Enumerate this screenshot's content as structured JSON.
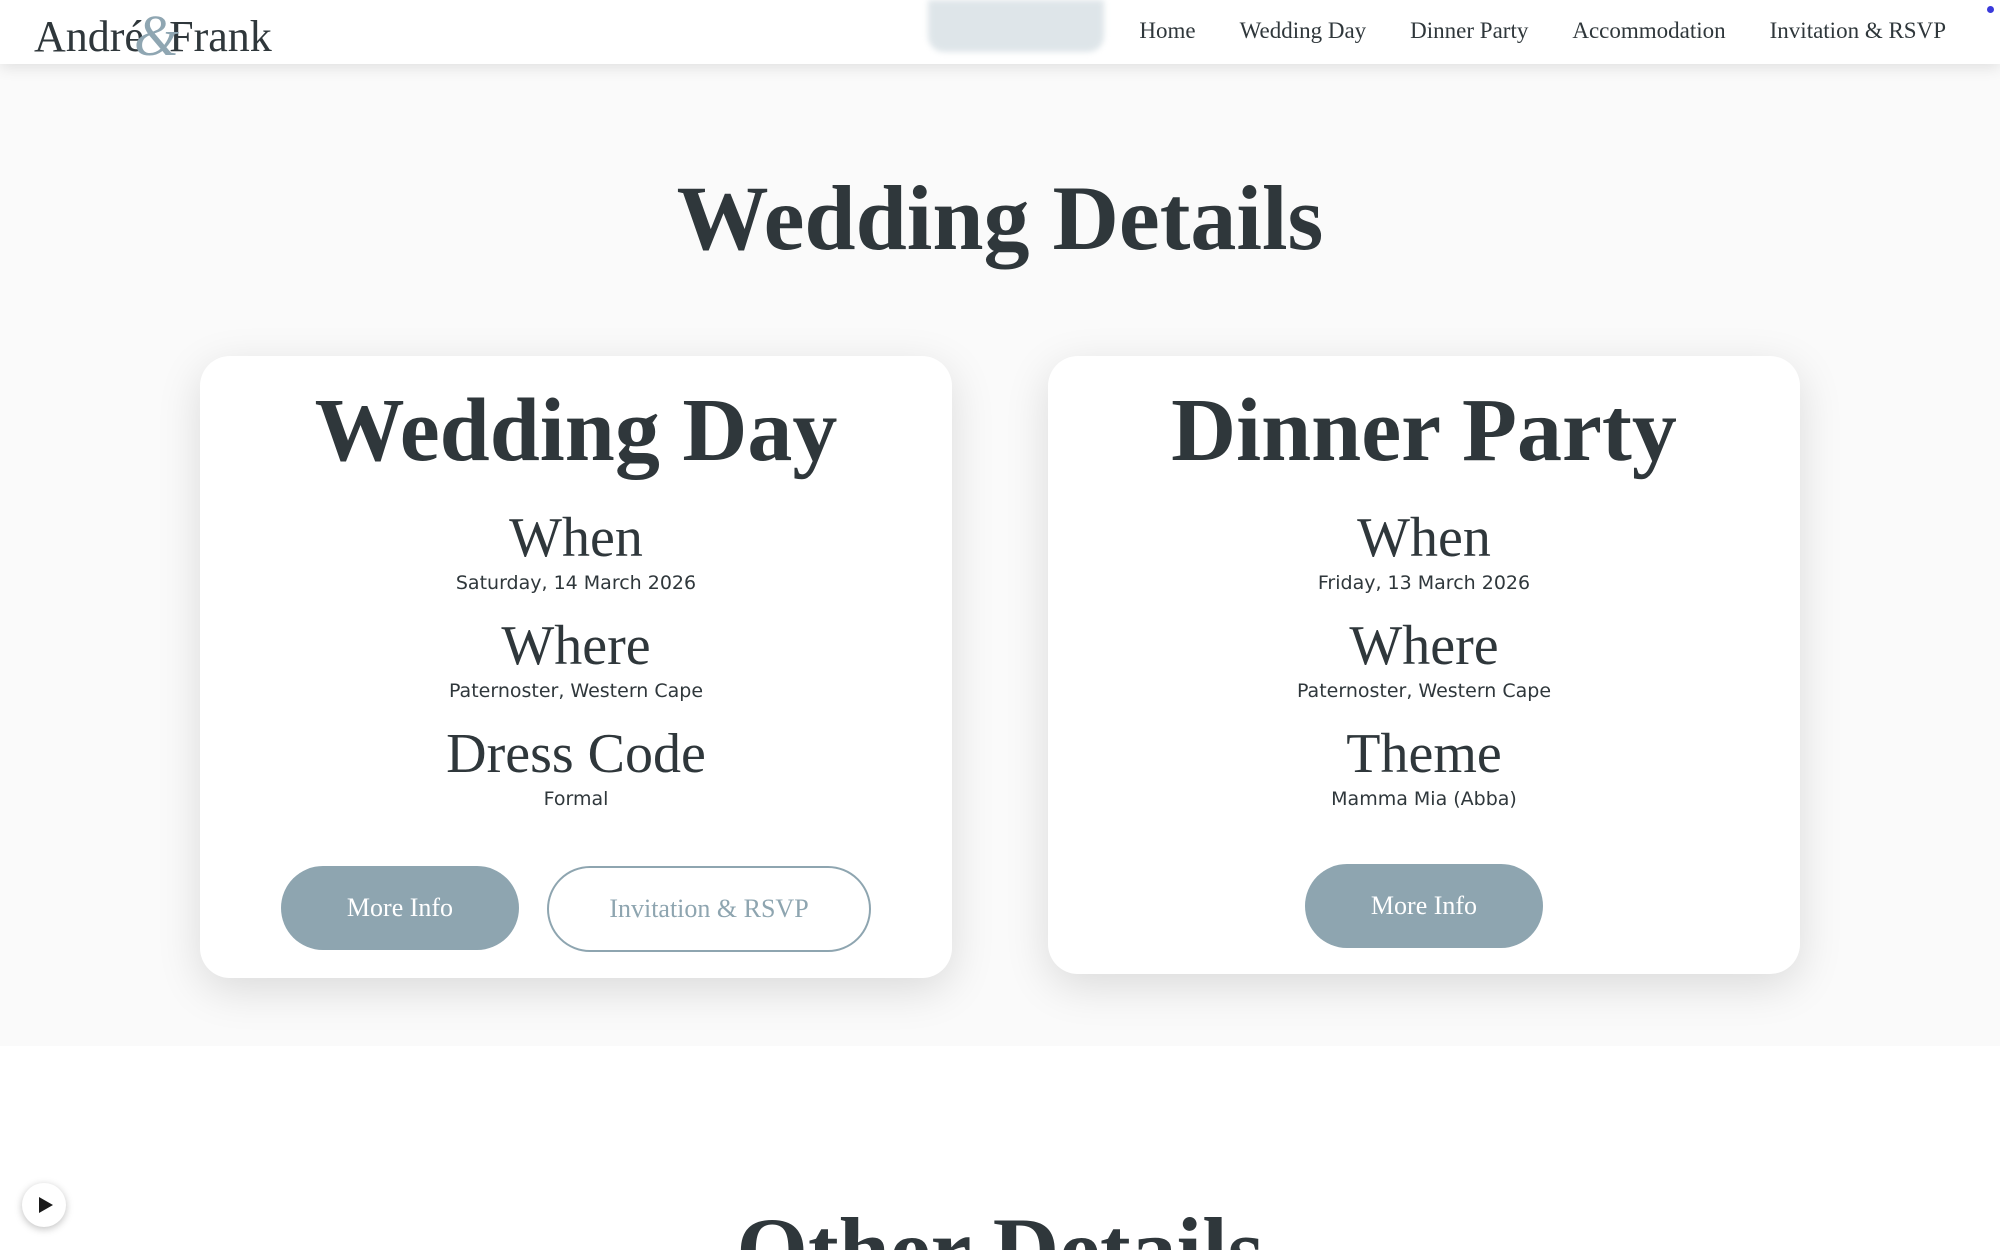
{
  "header": {
    "logo": {
      "first": "André",
      "amp": "&",
      "second": "Frank"
    },
    "nav": [
      "Home",
      "Wedding Day",
      "Dinner Party",
      "Accommodation",
      "Invitation & RSVP"
    ]
  },
  "details": {
    "title": "Wedding Details",
    "wedding_day": {
      "title": "Wedding Day",
      "when_label": "When",
      "when_value": "Saturday, 14 March 2026",
      "where_label": "Where",
      "where_value": "Paternoster, Western Cape",
      "dress_label": "Dress Code",
      "dress_value": "Formal",
      "more_info": "More Info",
      "rsvp": "Invitation & RSVP"
    },
    "dinner_party": {
      "title": "Dinner Party",
      "when_label": "When",
      "when_value": "Friday, 13 March 2026",
      "where_label": "Where",
      "where_value": "Paternoster, Western Cape",
      "theme_label": "Theme",
      "theme_value": "Mamma Mia (Abba)",
      "more_info": "More Info"
    }
  },
  "other": {
    "title": "Other Details"
  },
  "icons": {
    "play": "play-icon"
  },
  "colors": {
    "accent": "#8ea5b0",
    "text": "#2f373b",
    "background": "#fafafa"
  }
}
